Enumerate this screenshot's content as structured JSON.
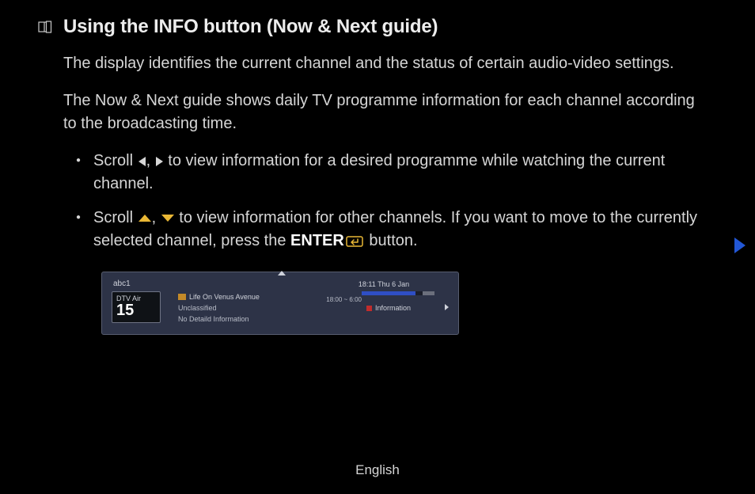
{
  "heading": "Using the INFO button (Now & Next guide)",
  "para1": "The display identifies the current channel and the status of certain audio-video settings.",
  "para2": "The Now & Next guide shows daily TV programme information for each channel according to the broadcasting time.",
  "bullet1_prefix": "Scroll ",
  "bullet1_sep": ", ",
  "bullet1_suffix": " to view information for a desired programme while watching the current channel.",
  "bullet2_prefix": "Scroll ",
  "bullet2_sep": ", ",
  "bullet2_mid": " to view information for other channels. If you want to move to the currently selected channel, press the ",
  "bullet2_enter": "ENTER",
  "bullet2_end": " button.",
  "guide": {
    "channel_name": "abc1",
    "ch_type": "DTV Air",
    "ch_num": "15",
    "prog_title": "Life On Venus Avenue",
    "prog_class": "Unclassified",
    "prog_desc": "No Detaild Information",
    "datetime": "18:11 Thu 6 Jan",
    "timerange": "18:00 ~ 6:00",
    "info_label": "Information"
  },
  "footer_lang": "English"
}
